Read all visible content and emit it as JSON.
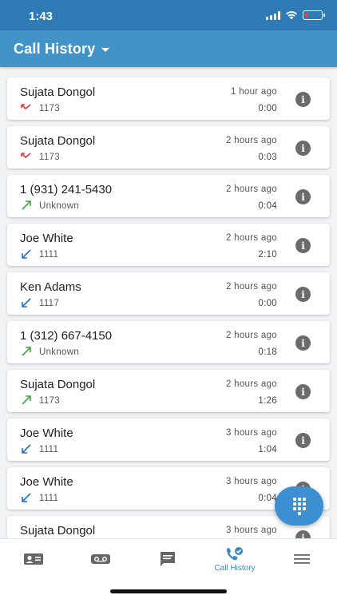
{
  "status_bar": {
    "time": "1:43"
  },
  "header": {
    "title": "Call History"
  },
  "calls": [
    {
      "name": "Sujata Dongol",
      "number": "1173",
      "time": "1 hour ago",
      "duration": "0:00",
      "direction": "missed"
    },
    {
      "name": "Sujata Dongol",
      "number": "1173",
      "time": "2 hours ago",
      "duration": "0:03",
      "direction": "missed"
    },
    {
      "name": "1 (931) 241-5430",
      "number": "Unknown",
      "time": "2 hours ago",
      "duration": "0:04",
      "direction": "outgoing"
    },
    {
      "name": "Joe White",
      "number": "1111",
      "time": "2 hours ago",
      "duration": "2:10",
      "direction": "incoming"
    },
    {
      "name": "Ken Adams",
      "number": "1117",
      "time": "2 hours ago",
      "duration": "0:00",
      "direction": "incoming"
    },
    {
      "name": "1 (312) 667-4150",
      "number": "Unknown",
      "time": "2 hours ago",
      "duration": "0:18",
      "direction": "outgoing"
    },
    {
      "name": "Sujata Dongol",
      "number": "1173",
      "time": "2 hours ago",
      "duration": "1:26",
      "direction": "outgoing"
    },
    {
      "name": "Joe White",
      "number": "1111",
      "time": "3 hours ago",
      "duration": "1:04",
      "direction": "incoming"
    },
    {
      "name": "Joe White",
      "number": "1111",
      "time": "3 hours ago",
      "duration": "0:04",
      "direction": "incoming"
    },
    {
      "name": "Sujata Dongol",
      "number": "",
      "time": "3 hours ago",
      "duration": "",
      "direction": ""
    }
  ],
  "icons": {
    "info": "info-icon",
    "missed": "missed-call-icon",
    "outgoing": "outgoing-call-icon",
    "incoming": "incoming-call-icon",
    "fab": "dialpad-icon"
  },
  "colors": {
    "header": "#4293c8",
    "status_bar": "#2e7bb5",
    "missed": "#e53935",
    "outgoing": "#43a047",
    "incoming": "#1e6fc7",
    "active_tab": "#3a87c4"
  },
  "bottom_nav": {
    "items": [
      {
        "icon": "contacts-icon",
        "label": ""
      },
      {
        "icon": "voicemail-icon",
        "label": ""
      },
      {
        "icon": "messages-icon",
        "label": ""
      },
      {
        "icon": "call-history-icon",
        "label": "Call History",
        "active": true
      },
      {
        "icon": "menu-icon",
        "label": ""
      }
    ]
  }
}
